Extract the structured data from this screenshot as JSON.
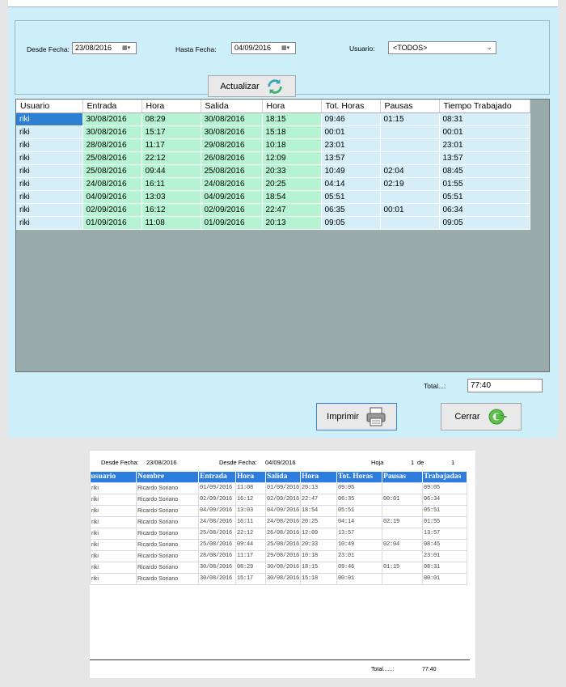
{
  "filters": {
    "desde_label": "Desde Fecha:",
    "desde_value": "23/08/2016",
    "hasta_label": "Hasta Fecha:",
    "hasta_value": "04/09/2016",
    "usuario_label": "Usuario:",
    "usuario_value": "<TODOS>"
  },
  "buttons": {
    "actualizar": "Actualizar",
    "imprimir": "Imprimir",
    "cerrar": "Cerrar"
  },
  "grid": {
    "headers": [
      "Usuario",
      "Entrada",
      "Hora",
      "Salida",
      "Hora",
      "Tot. Horas",
      "Pausas",
      "Tiempo Trabajado"
    ],
    "rows": [
      [
        "riki",
        "30/08/2016",
        "08:29",
        "30/08/2016",
        "18:15",
        "09:46",
        "01:15",
        "08:31"
      ],
      [
        "riki",
        "30/08/2016",
        "15:17",
        "30/08/2016",
        "15:18",
        "00:01",
        "",
        "00:01"
      ],
      [
        "riki",
        "28/08/2016",
        "11:17",
        "29/08/2016",
        "10:18",
        "23:01",
        "",
        "23:01"
      ],
      [
        "riki",
        "25/08/2016",
        "22:12",
        "26/08/2016",
        "12:09",
        "13:57",
        "",
        "13:57"
      ],
      [
        "riki",
        "25/08/2016",
        "09:44",
        "25/08/2016",
        "20:33",
        "10:49",
        "02:04",
        "08:45"
      ],
      [
        "riki",
        "24/08/2016",
        "16:11",
        "24/08/2016",
        "20:25",
        "04:14",
        "02:19",
        "01:55"
      ],
      [
        "riki",
        "04/09/2016",
        "13:03",
        "04/09/2016",
        "18:54",
        "05:51",
        "",
        "05:51"
      ],
      [
        "riki",
        "02/09/2016",
        "16:12",
        "02/09/2016",
        "22:47",
        "06:35",
        "00:01",
        "06:34"
      ],
      [
        "riki",
        "01/09/2016",
        "11:08",
        "01/09/2016",
        "20:13",
        "09:05",
        "",
        "09:05"
      ]
    ]
  },
  "total": {
    "label": "Total...:",
    "value": "77:40"
  },
  "report": {
    "desde_label": "Desde Fecha:",
    "desde_value": "23/08/2016",
    "hasta_label": "Desde Fecha:",
    "hasta_value": "04/09/2016",
    "hoja_label": "Hoja",
    "hoja_value": "1",
    "de_label": "de",
    "de_value": "1",
    "headers": [
      "usuario",
      "Nombre",
      "Entrada",
      "Hora",
      "Salida",
      "Hora",
      "Tot. Horas",
      "Pausas",
      "Trabajadas"
    ],
    "rows": [
      [
        "riki",
        "Ricardo Soriano",
        "01/09/2016",
        "11:08",
        "01/09/2016",
        "20:13",
        "09:05",
        "",
        "09:05"
      ],
      [
        "riki",
        "Ricardo Soriano",
        "02/09/2016",
        "16:12",
        "02/09/2016",
        "22:47",
        "06:35",
        "00:01",
        "06:34"
      ],
      [
        "riki",
        "Ricardo Soriano",
        "04/09/2016",
        "13:03",
        "04/09/2016",
        "18:54",
        "05:51",
        "",
        "05:51"
      ],
      [
        "riki",
        "Ricardo Soriano",
        "24/08/2016",
        "16:11",
        "24/08/2016",
        "20:25",
        "04:14",
        "02:19",
        "01:55"
      ],
      [
        "riki",
        "Ricardo Soriano",
        "25/08/2016",
        "22:12",
        "26/08/2016",
        "12:09",
        "13:57",
        "",
        "13:57"
      ],
      [
        "riki",
        "Ricardo Soriano",
        "25/08/2016",
        "09:44",
        "25/08/2016",
        "20:33",
        "10:49",
        "02:04",
        "08:45"
      ],
      [
        "riki",
        "Ricardo Soriano",
        "28/08/2016",
        "11:17",
        "29/08/2016",
        "10:18",
        "23:01",
        "",
        "23:01"
      ],
      [
        "riki",
        "Ricardo Soriano",
        "30/08/2016",
        "08:29",
        "30/08/2016",
        "18:15",
        "09:46",
        "01:15",
        "08:31"
      ],
      [
        "riki",
        "Ricardo Soriano",
        "30/08/2016",
        "15:17",
        "30/08/2016",
        "15:18",
        "00:01",
        "",
        "00:01"
      ]
    ],
    "total_label": "Total......:",
    "total_value": "77:40"
  }
}
